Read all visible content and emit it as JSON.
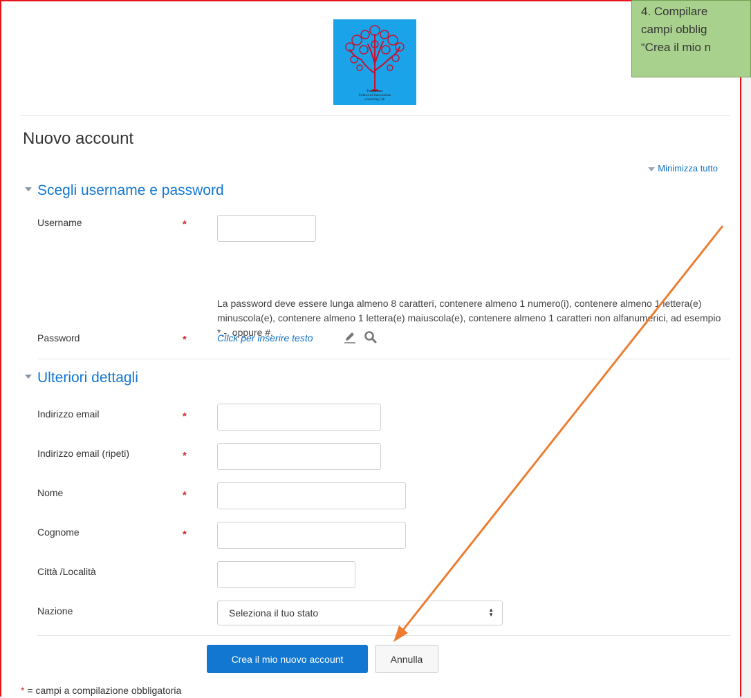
{
  "logo": {
    "caption": [
      "Fondazione",
      "Cultura ed innovazione",
      "e-learning Lab"
    ]
  },
  "page": {
    "title": "Nuovo account",
    "collapse_all": "Minimizza tutto"
  },
  "section1": {
    "legend": "Scegli username e password",
    "username_label": "Username",
    "password_policy": "La password deve essere lunga almeno 8 caratteri, contenere almeno 1 numero(i), contenere almeno 1 lettera(e) minuscola(e), contenere almeno 1 lettera(e) maiuscola(e), contenere almeno 1 caratteri non alfanumerici, ad esempio *,-, oppure #.",
    "password_label": "Password",
    "password_edit_text": "Click per inserire testo"
  },
  "section2": {
    "legend": "Ulteriori dettagli",
    "email_label": "Indirizzo email",
    "email2_label": "Indirizzo email (ripeti)",
    "firstname_label": "Nome",
    "lastname_label": "Cognome",
    "city_label": "Città /Località",
    "country_label": "Nazione",
    "country_selected": "Seleziona il tuo stato"
  },
  "buttons": {
    "submit": "Crea il mio nuovo account",
    "cancel": "Annulla"
  },
  "required_mark": "*",
  "footnote": "= campi a compilazione obbligatoria",
  "callout": {
    "lines": [
      "4. Compilare",
      "campi obblig",
      "“Crea il mio n"
    ]
  },
  "colors": {
    "accent": "#1177d1",
    "required": "#c9302c",
    "frame": "#e8141b",
    "callout_bg": "#a9d18e",
    "arrow": "#ed7d31"
  },
  "icons": [
    "pencil-icon",
    "magnifier-icon",
    "collapse-triangle-icon",
    "select-arrows-icon"
  ]
}
